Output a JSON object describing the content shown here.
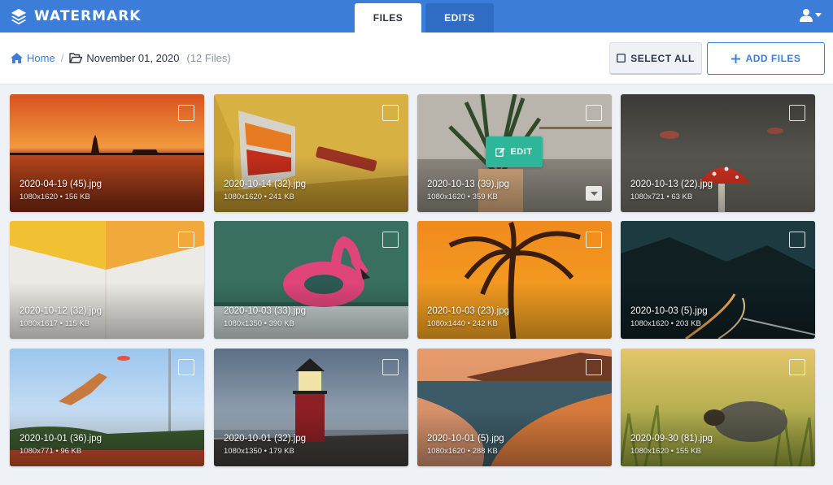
{
  "app": {
    "name": "WATERMARK"
  },
  "tabs": [
    {
      "label": "FILES",
      "active": true
    },
    {
      "label": "EDITS",
      "active": false
    }
  ],
  "breadcrumb": {
    "home": "Home",
    "folder": "November 01, 2020",
    "count": "(12 Files)"
  },
  "toolbar": {
    "select_all": "SELECT ALL",
    "add_files": "ADD FILES"
  },
  "colors": {
    "brand": "#3b7dd8",
    "accent": "#2fb59a"
  },
  "hover_card": {
    "edit_label": "EDIT"
  },
  "files": [
    {
      "name": "2020-04-19 (45).jpg",
      "meta": "1080x1620 • 156 KB"
    },
    {
      "name": "2020-10-14 (32).jpg",
      "meta": "1080x1620 • 241 KB"
    },
    {
      "name": "2020-10-13 (39).jpg",
      "meta": "1080x1620 • 359 KB"
    },
    {
      "name": "2020-10-13 (22).jpg",
      "meta": "1080x721 • 63 KB"
    },
    {
      "name": "2020-10-12 (32).jpg",
      "meta": "1080x1617 • 115 KB"
    },
    {
      "name": "2020-10-03 (33).jpg",
      "meta": "1080x1350 • 390 KB"
    },
    {
      "name": "2020-10-03 (23).jpg",
      "meta": "1080x1440 • 242 KB"
    },
    {
      "name": "2020-10-03 (5).jpg",
      "meta": "1080x1620 • 203 KB"
    },
    {
      "name": "2020-10-01 (36).jpg",
      "meta": "1080x771 • 96 KB"
    },
    {
      "name": "2020-10-01 (32).jpg",
      "meta": "1080x1350 • 179 KB"
    },
    {
      "name": "2020-10-01 (5).jpg",
      "meta": "1080x1620 • 288 KB"
    },
    {
      "name": "2020-09-30 (81).jpg",
      "meta": "1080x1620 • 155 KB"
    }
  ]
}
